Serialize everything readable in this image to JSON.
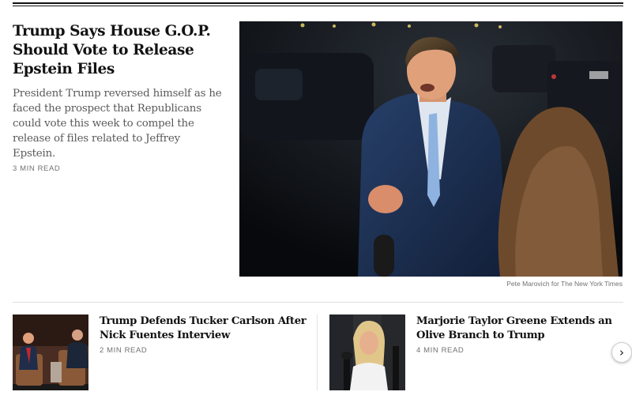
{
  "lead_story": {
    "headline": "Trump Says House G.O.P. Should Vote to Release Epstein Files",
    "summary": "President Trump reversed himself as he faced the prospect that Republicans could vote this week to compel the release of files related to Jeffrey Epstein.",
    "read_time": "3 MIN READ",
    "image_credit": "Pete Marovich for The New York Times"
  },
  "related_stories": [
    {
      "headline": "Trump Defends Tucker Carlson After Nick Fuentes Interview",
      "read_time": "2 MIN READ"
    },
    {
      "headline": "Marjorie Taylor Greene Extends an Olive Branch to Trump",
      "read_time": "4 MIN READ"
    }
  ],
  "carousel": {
    "next_icon": "chevron-right-icon",
    "next_glyph": "›"
  },
  "colors": {
    "text": "#121212",
    "summary": "#5a5a5a",
    "meta": "#727272",
    "rule": "#dfdfdf"
  }
}
